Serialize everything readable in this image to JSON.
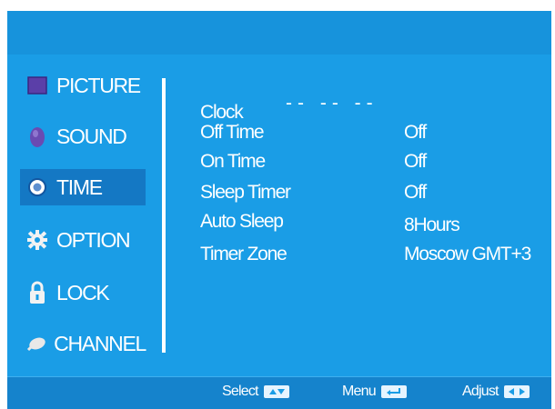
{
  "menu": {
    "items": [
      {
        "label": "PICTURE",
        "icon": "picture-icon"
      },
      {
        "label": "SOUND",
        "icon": "sound-icon"
      },
      {
        "label": "TIME",
        "icon": "clock-icon",
        "selected": true
      },
      {
        "label": "OPTION",
        "icon": "gear-icon"
      },
      {
        "label": "LOCK",
        "icon": "lock-icon"
      },
      {
        "label": "CHANNEL",
        "icon": "satellite-icon"
      }
    ]
  },
  "settings": {
    "clock": {
      "label": "Clock",
      "value": "--  --  --"
    },
    "rows": [
      {
        "label": "Off Time",
        "value": "Off"
      },
      {
        "label": "On Time",
        "value": "Off"
      },
      {
        "label": "Sleep Timer",
        "value": "Off"
      },
      {
        "label": "Auto Sleep",
        "value": "8Hours"
      },
      {
        "label": "Timer Zone",
        "value": "Moscow GMT+3"
      }
    ]
  },
  "footer": {
    "select_label": "Select",
    "menu_label": "Menu",
    "adjust_label": "Adjust"
  },
  "colors": {
    "background": "#1a9de6",
    "selected": "#1478c4",
    "text": "#ffffff"
  }
}
